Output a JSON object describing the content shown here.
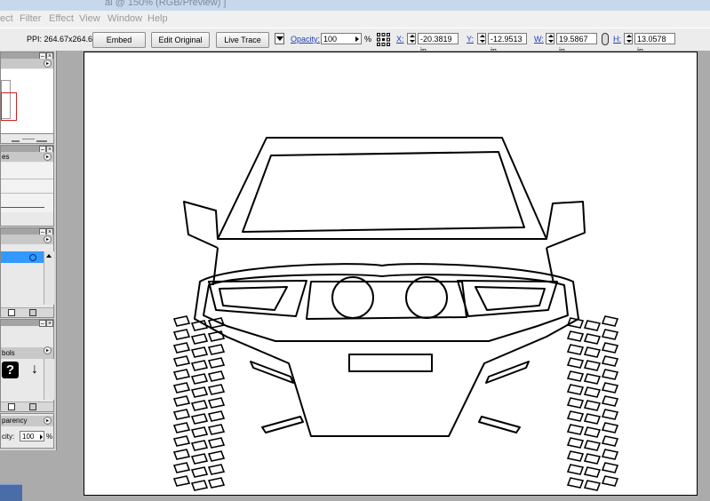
{
  "window": {
    "title": "ai @ 150% (RGB/Preview) ]"
  },
  "menu": [
    "ect",
    "Filter",
    "Effect",
    "View",
    "Window",
    "Help"
  ],
  "control_bar": {
    "ppi": "PPI: 264.67x264.67",
    "embed_label": "Embed",
    "edit_original_label": "Edit Original",
    "live_trace_label": "Live Trace",
    "opacity_label": "Opacity:",
    "opacity_value": "100",
    "percent": "%",
    "x_label": "X:",
    "x_value": "-20.3819 in",
    "y_label": "Y:",
    "y_value": "-12.9513 in",
    "w_label": "W:",
    "w_value": "19.5867 in",
    "h_label": "H:",
    "h_value": "13.0578 in"
  },
  "panels": {
    "styles_tab": "es",
    "symbols_tab": "bols",
    "symbol_question": "?",
    "symbol_arrow": "↓",
    "transparency_tab": "parency",
    "opacity_label": "city:",
    "opacity_value": "100",
    "opacity_unit": "%"
  },
  "colors": {
    "accent": "#3399ff",
    "ui_bg": "#ececec",
    "canvas_bg": "#ababab"
  }
}
